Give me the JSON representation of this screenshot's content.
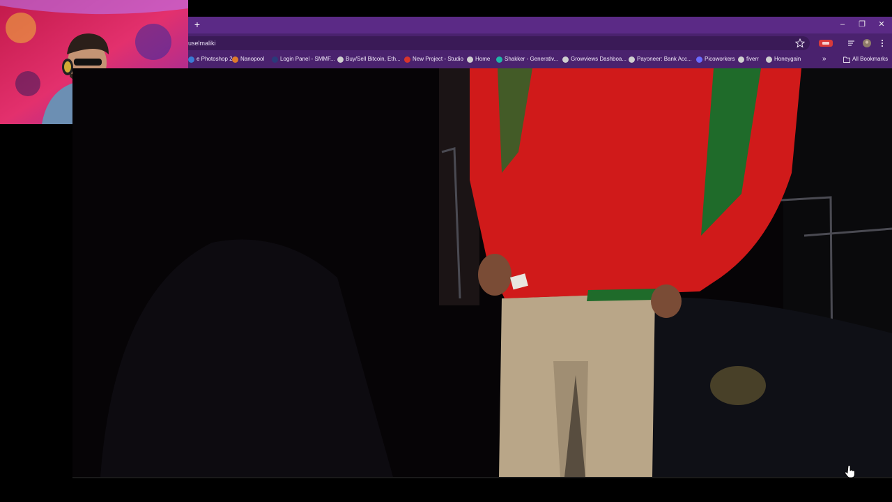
{
  "browser": {
    "new_tab_label": "+",
    "window_controls": {
      "minimize": "–",
      "restore": "❐",
      "close": "✕"
    },
    "address_bar": {
      "url_text": "uselmaliki"
    },
    "icons": [
      "star-icon",
      "extension-icon",
      "tab-search-icon",
      "profile-avatar",
      "menu-icon"
    ]
  },
  "bookmarks": {
    "items": [
      {
        "label": "e Photoshop 2...",
        "icon": "photoshop-icon",
        "color": "#3a7bd5"
      },
      {
        "label": "Nanopool",
        "icon": "nanopool-icon",
        "color": "#e07b2a"
      },
      {
        "label": "Login Panel - SMMF...",
        "icon": "smm-icon",
        "color": "#2a3a7a"
      },
      {
        "label": "Buy/Sell Bitcoin, Eth...",
        "icon": "globe-icon",
        "color": "#cfcfcf"
      },
      {
        "label": "New Project - Studio",
        "icon": "studio-icon",
        "color": "#d8342c"
      },
      {
        "label": "Home",
        "icon": "globe-icon",
        "color": "#cfcfcf"
      },
      {
        "label": "Shakker - Generativ...",
        "icon": "shakker-icon",
        "color": "#1fb5a8"
      },
      {
        "label": "Growviews Dashboa...",
        "icon": "globe-icon",
        "color": "#cfcfcf"
      },
      {
        "label": "Payoneer: Bank Acc...",
        "icon": "globe-icon",
        "color": "#cfcfcf"
      },
      {
        "label": "Picoworkers",
        "icon": "picoworkers-icon",
        "color": "#6a6aff"
      },
      {
        "label": "fiverr",
        "icon": "globe-icon",
        "color": "#cfcfcf"
      },
      {
        "label": "Honeygain",
        "icon": "globe-icon",
        "color": "#cfcfcf"
      }
    ],
    "overflow_label": "»",
    "all_bookmarks_label": "All Bookmarks"
  },
  "colors": {
    "tabstrip": "#5b2a86",
    "toolbar": "#4a226e",
    "video_bg": "#060406",
    "jacket_red": "#d01a1a",
    "jacket_green": "#1f6b2a",
    "pants_tan": "#b9a688"
  }
}
